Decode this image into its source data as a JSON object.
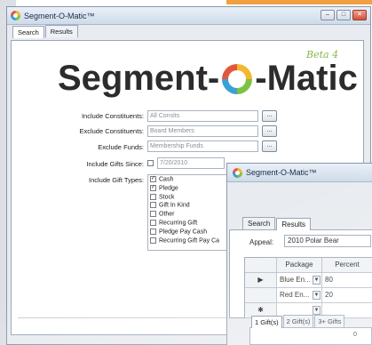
{
  "main_window": {
    "title": "Segment-O-Matic™",
    "tabs": [
      {
        "label": "Search"
      },
      {
        "label": "Results"
      }
    ],
    "logo": {
      "left": "Segment-",
      "right": "-Matic",
      "badge": "Beta 4"
    },
    "form": {
      "include_constituents": {
        "label": "Include Constituents:",
        "value": "All Consits"
      },
      "exclude_constituents": {
        "label": "Exclude Constituents:",
        "value": "Board Members"
      },
      "exclude_funds": {
        "label": "Exclude Funds:",
        "value": "Membership Funds"
      },
      "include_gifts_since": {
        "label": "Include Gifts Since:",
        "checked": false,
        "value": "7/20/2010"
      },
      "include_gift_types": {
        "label": "Include Gift Types:",
        "options": [
          {
            "label": "Cash",
            "checked": true
          },
          {
            "label": "Pledge",
            "checked": true
          },
          {
            "label": "Stock",
            "checked": false
          },
          {
            "label": "Gift In Kind",
            "checked": false
          },
          {
            "label": "Other",
            "checked": false
          },
          {
            "label": "Recurring Gift",
            "checked": false
          },
          {
            "label": "Pledge Pay Cash",
            "checked": false
          },
          {
            "label": "Recurring Gift Pay Ca",
            "checked": false
          }
        ]
      },
      "ellipsis_label": "..."
    }
  },
  "results_window": {
    "title": "Segment-O-Matic™",
    "tabs": [
      {
        "label": "Search"
      },
      {
        "label": "Results"
      }
    ],
    "appeal": {
      "label": "Appeal:",
      "value": "2010 Polar Bear"
    },
    "grid": {
      "headers": {
        "package": "Package",
        "percent": "Percent"
      },
      "rows": [
        {
          "selector": "▶",
          "package": "Blue En...",
          "percent": "80"
        },
        {
          "selector": "",
          "package": "Red En...",
          "percent": "20"
        },
        {
          "selector": "✱",
          "package": "",
          "percent": ""
        }
      ]
    },
    "gift_tabs": [
      {
        "label": "1 Gift(s)"
      },
      {
        "label": "2 Gift(s)"
      },
      {
        "label": "3+ Gifts"
      }
    ],
    "gift_value": "0"
  },
  "icons": [
    "app-icon",
    "minimize-icon",
    "maximize-icon",
    "close-icon",
    "dropdown-arrow-icon"
  ]
}
